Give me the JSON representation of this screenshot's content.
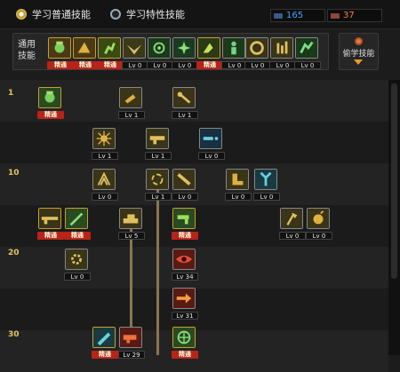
{
  "tabs": {
    "normal_label": "学习普通技能",
    "trait_label": "学习特性技能"
  },
  "sp": {
    "blue_value": "165",
    "red_value": "37"
  },
  "general": {
    "label": "通用技能",
    "skills": [
      {
        "name": "general-skill-1",
        "badge": "精通",
        "badge_type": "ct",
        "icon": "bag-icon",
        "bg": "#4a3a14"
      },
      {
        "name": "general-skill-2",
        "badge": "精通",
        "badge_type": "ct",
        "icon": "leap-icon",
        "bg": "#4a3a14"
      },
      {
        "name": "general-skill-3",
        "badge": "精通",
        "badge_type": "ct",
        "icon": "runner-icon",
        "bg": "#3a4a14"
      },
      {
        "name": "general-skill-4",
        "badge": "Lv 0",
        "badge_type": "lv",
        "icon": "wings-icon",
        "bg": "#3a3a18"
      },
      {
        "name": "general-skill-5",
        "badge": "Lv 0",
        "badge_type": "lv",
        "icon": "crosshair-icon",
        "bg": "#1a3a1a"
      },
      {
        "name": "general-skill-6",
        "badge": "Lv 0",
        "badge_type": "lv",
        "icon": "star-icon",
        "bg": "#1a3a22"
      },
      {
        "name": "general-skill-7",
        "badge": "精通",
        "badge_type": "ct",
        "icon": "dodge-icon",
        "bg": "#2a3a14"
      },
      {
        "name": "general-skill-8",
        "badge": "Lv 0",
        "badge_type": "lv",
        "icon": "figure-icon",
        "bg": "#1a3a1a"
      },
      {
        "name": "general-skill-9",
        "badge": "Lv 0",
        "badge_type": "lv",
        "icon": "ring-icon",
        "bg": "#3a3418"
      },
      {
        "name": "general-skill-10",
        "badge": "Lv 0",
        "badge_type": "lv",
        "icon": "bars-icon",
        "bg": "#3a3418"
      },
      {
        "name": "general-skill-11",
        "badge": "Lv 0",
        "badge_type": "lv",
        "icon": "sprint-icon",
        "bg": "#1a3a1a"
      }
    ]
  },
  "steal": {
    "label": "偷学技能"
  },
  "levels": {
    "l1": "1",
    "l10": "10",
    "l20": "20",
    "l30": "30"
  },
  "tree_skills": [
    {
      "name": "tree-skill-r1-a",
      "badge": "精通",
      "badge_type": "ct",
      "icon": "bag-icon",
      "bg": "#2a4a22"
    },
    {
      "name": "tree-skill-r1-b",
      "badge": "Lv 1",
      "badge_type": "lv",
      "icon": "kick-icon",
      "bg": "#3a3418"
    },
    {
      "name": "tree-skill-r1-c",
      "badge": "Lv 1",
      "badge_type": "lv",
      "icon": "swing-icon",
      "bg": "#3a3418"
    },
    {
      "name": "tree-skill-r2-a",
      "badge": "Lv 1",
      "badge_type": "lv",
      "icon": "burst-icon",
      "bg": "#3a3418"
    },
    {
      "name": "tree-skill-r2-b",
      "badge": "Lv 1",
      "badge_type": "lv",
      "icon": "gun-icon",
      "bg": "#3a3418"
    },
    {
      "name": "tree-skill-r2-c",
      "badge": "Lv 0",
      "badge_type": "lv",
      "icon": "shot-icon",
      "bg": "#183040"
    },
    {
      "name": "tree-skill-r3-a",
      "badge": "Lv 0",
      "badge_type": "lv",
      "icon": "claw-icon",
      "bg": "#3a3418"
    },
    {
      "name": "tree-skill-r3-b",
      "badge": "Lv 1",
      "badge_type": "lv",
      "icon": "spin-icon",
      "bg": "#3a3418"
    },
    {
      "name": "tree-skill-r3-c",
      "badge": "Lv 0",
      "badge_type": "lv",
      "icon": "slash-icon",
      "bg": "#3a3418"
    },
    {
      "name": "tree-skill-r3-d",
      "badge": "Lv 0",
      "badge_type": "lv",
      "icon": "boot-icon",
      "bg": "#3a3418"
    },
    {
      "name": "tree-skill-r3-e",
      "badge": "Lv 0",
      "badge_type": "lv",
      "icon": "fork-icon",
      "bg": "#183a40"
    },
    {
      "name": "tree-skill-r4-a",
      "badge": "精通",
      "badge_type": "ct",
      "icon": "rifle-icon",
      "bg": "#3a3418"
    },
    {
      "name": "tree-skill-r4-b",
      "badge": "精通",
      "badge_type": "ct",
      "icon": "blade-icon",
      "bg": "#2a4a22"
    },
    {
      "name": "tree-skill-r4-c",
      "badge": "Lv 5",
      "badge_type": "lv",
      "icon": "tank-icon",
      "bg": "#3a3418"
    },
    {
      "name": "tree-skill-r4-d",
      "badge": "精通",
      "badge_type": "ct",
      "icon": "pistol-icon",
      "bg": "#2a4a22"
    },
    {
      "name": "tree-skill-r4-e",
      "badge": "Lv 0",
      "badge_type": "lv",
      "icon": "axe-icon",
      "bg": "#3a3418"
    },
    {
      "name": "tree-skill-r4-f",
      "badge": "Lv 0",
      "badge_type": "lv",
      "icon": "bomb-icon",
      "bg": "#3a3418"
    },
    {
      "name": "tree-skill-r5-a",
      "badge": "Lv 0",
      "badge_type": "lv",
      "icon": "gear-icon",
      "bg": "#3a3418"
    },
    {
      "name": "tree-skill-r5-b",
      "badge": "Lv 34",
      "badge_type": "lv",
      "icon": "eye-icon",
      "bg": "#5a1a14"
    },
    {
      "name": "tree-skill-r6-a",
      "badge": "Lv 31",
      "badge_type": "lv",
      "icon": "arrow-icon",
      "bg": "#5a1a14"
    },
    {
      "name": "tree-skill-r7-a",
      "badge": "精通",
      "badge_type": "ct",
      "icon": "cannon-icon",
      "bg": "#183a40"
    },
    {
      "name": "tree-skill-r7-b",
      "badge": "Lv 29",
      "badge_type": "lv",
      "icon": "launcher-icon",
      "bg": "#5a1a14"
    },
    {
      "name": "tree-skill-r7-c",
      "badge": "精通",
      "badge_type": "ct",
      "icon": "mech-icon",
      "bg": "#2a4a22"
    }
  ]
}
